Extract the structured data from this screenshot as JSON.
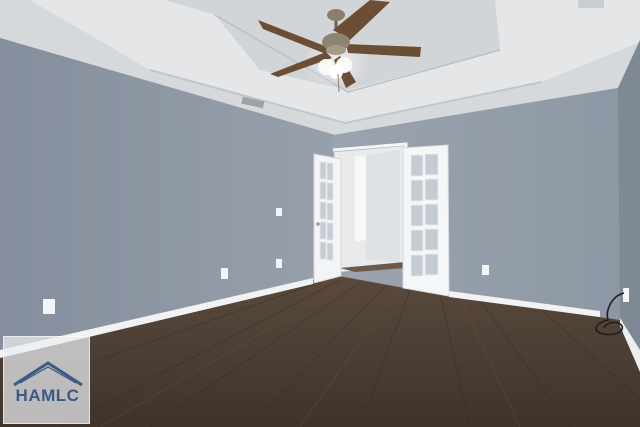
{
  "photo": {
    "subject": "empty-bedroom",
    "colors": {
      "wall": "#8c96a4",
      "ceiling": "#dde0e2",
      "trim": "#f4f5f6",
      "floor": "#4b3d32"
    }
  },
  "watermark": {
    "text": "HAMLC",
    "color": "#3a5a86"
  }
}
